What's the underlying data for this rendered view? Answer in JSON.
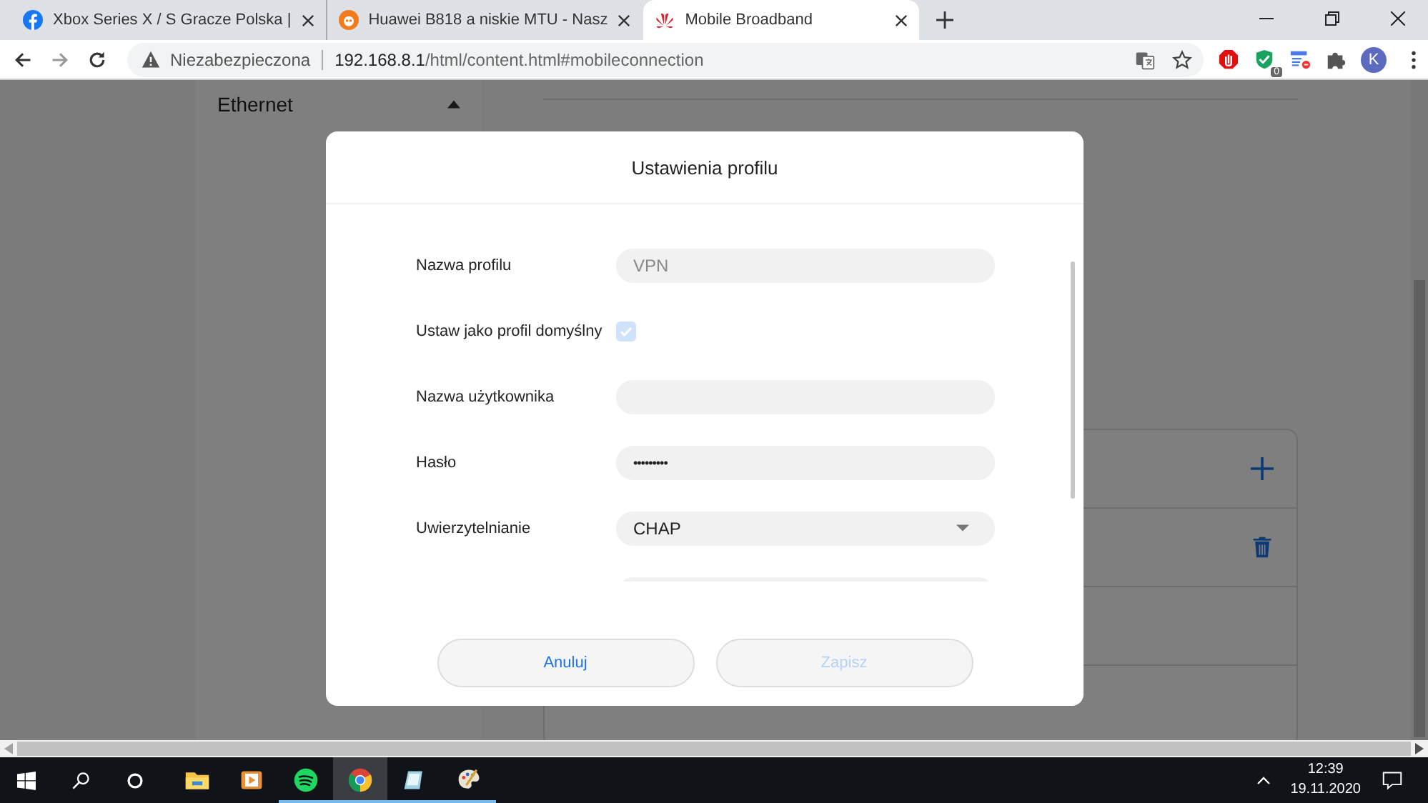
{
  "tabs": [
    {
      "title": "Xbox Series X / S Gracze Polska |",
      "selected": false
    },
    {
      "title": "Huawei B818 a niskie MTU - Nasz",
      "selected": false
    },
    {
      "title": "Mobile Broadband",
      "selected": true
    }
  ],
  "address_bar": {
    "security": "Niezabezpieczona",
    "url_host": "192.168.8.1",
    "url_path": "/html/content.html#mobileconnection"
  },
  "extensions": {
    "badge": "0",
    "avatar": "K"
  },
  "sidebar": {
    "label": "Ethernet",
    "expanded": true
  },
  "modal": {
    "title": "Ustawienia profilu",
    "fields": [
      {
        "kind": "text",
        "label": "Nazwa profilu",
        "value": "VPN",
        "disabled": true
      },
      {
        "kind": "checkbox",
        "label": "Ustaw jako profil domyślny",
        "checked": true,
        "disabled": true
      },
      {
        "kind": "text",
        "label": "Nazwa użytkownika"
      },
      {
        "kind": "password",
        "label": "Hasło",
        "value": "•••••••••"
      },
      {
        "kind": "select",
        "label": "Uwierzytelnianie",
        "value": "CHAP"
      },
      {
        "kind": "text"
      }
    ],
    "buttons": [
      {
        "label": "Anuluj",
        "disabled": false
      },
      {
        "label": "Zapisz",
        "disabled": true
      }
    ]
  },
  "taskbar": {
    "apps": [
      {
        "kind": "explorer",
        "open": false,
        "selected": false
      },
      {
        "kind": "media",
        "open": false,
        "selected": false
      },
      {
        "kind": "spotify",
        "open": true,
        "selected": false
      },
      {
        "kind": "chrome",
        "open": true,
        "selected": true
      },
      {
        "kind": "notes",
        "open": true,
        "selected": false
      },
      {
        "kind": "paint",
        "open": true,
        "selected": false
      }
    ],
    "time": "12:39",
    "date": "19.11.2020"
  }
}
